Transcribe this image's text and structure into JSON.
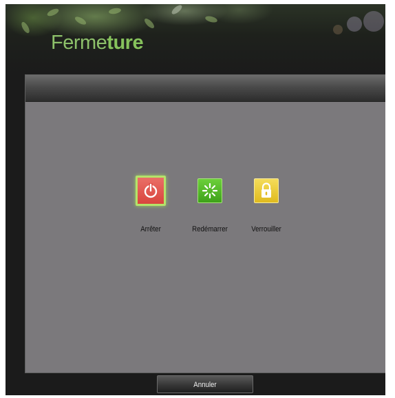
{
  "header": {
    "title_part1": "Ferme",
    "title_part2": "ture"
  },
  "actions": [
    {
      "label": "Arrêter",
      "icon": "power-icon",
      "color": "#d9453e",
      "selected": true
    },
    {
      "label": "Redémarrer",
      "icon": "restart-spinner-icon",
      "color": "#3ea21a",
      "selected": false
    },
    {
      "label": "Verrouiller",
      "icon": "padlock-icon",
      "color": "#e0bb1e",
      "selected": false
    }
  ],
  "footer": {
    "cancel_label": "Annuler"
  },
  "colors": {
    "title_accent": "#8dc06a",
    "panel_background": "#7b797c",
    "selection_highlight": "#b4e36a"
  }
}
